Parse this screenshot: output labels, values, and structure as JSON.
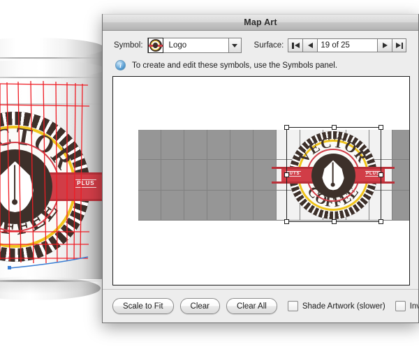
{
  "window": {
    "title": "Map Art"
  },
  "symbol_row": {
    "label": "Symbol:",
    "thumbnail_icon": "logo-symbol-thumbnail",
    "value": "Logo",
    "dropdown_icon": "chevron-down-icon"
  },
  "surface_row": {
    "label": "Surface:",
    "first_icon": "first-surface-icon",
    "prev_icon": "previous-surface-icon",
    "value": "19 of 25",
    "next_icon": "next-surface-icon",
    "last_icon": "last-surface-icon"
  },
  "info_row": {
    "icon": "info-icon",
    "text": "To create and edit these symbols, use the Symbols panel."
  },
  "toolbar": {
    "scale_to_fit": "Scale to Fit",
    "clear": "Clear",
    "clear_all": "Clear All",
    "shade_artwork": "Shade Artwork (slower)",
    "invisible_geometry": "Invisible G"
  },
  "canvas": {
    "grid": {
      "columns": 13,
      "rows": 3,
      "light_start_col": 6,
      "light_end_col": 10,
      "gray_color": "#969696",
      "light_color": "#f2f2f2",
      "line_color": "#808080"
    },
    "selection": {
      "handle_count": 8,
      "handle_fill": "#ffffff",
      "handle_stroke": "#1c1c1c"
    }
  },
  "logo": {
    "top_text": "VECTOR",
    "bottom_text": "COFFEE",
    "band_left": "TUTS",
    "band_right": "PLUS",
    "colors": {
      "scallop": "#3d302a",
      "ring_yellow": "#f0c41b",
      "ring_red": "#d13d47",
      "band": "#d13d47",
      "disc": "#3d302a",
      "nib": "#ffffff"
    }
  },
  "artwork": {
    "name": "coffee-cup-3d-render",
    "guide_color": "#ee1c24",
    "path_color": "#3b7fd4"
  }
}
